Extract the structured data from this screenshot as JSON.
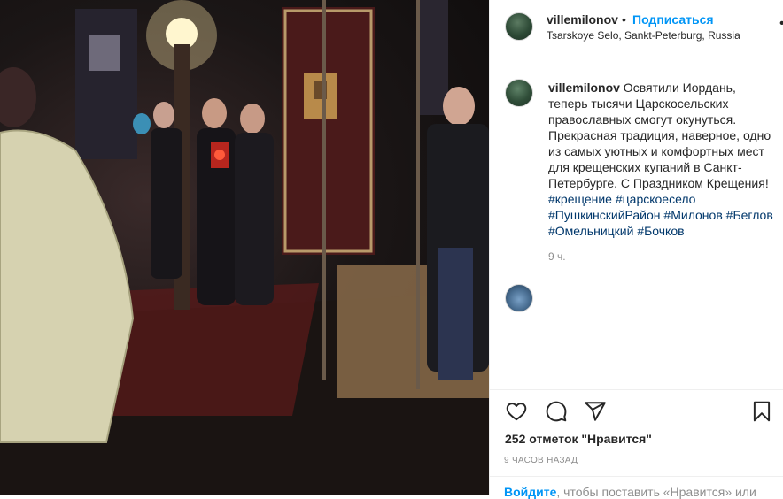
{
  "post": {
    "image_alt": "",
    "author": "villemilonov",
    "separator": "•",
    "follow_label": "Подписаться",
    "location": "Tsarskoye Selo, Sankt-Peterburg, Russia",
    "more_label": "•••"
  },
  "caption": {
    "author": "villemilonov",
    "text": " Освятили Иордань, теперь тысячи Царскосельских православных смогут окунуться. Прекрасная традиция, наверное, одно из самых уютных и комфортных мест для крещенских купаний в Санкт-Петербурге. С Праздником Крещения! ",
    "hashtags": [
      "#крещение",
      "#царскоеселo",
      "#ПушкинскийРайон",
      "#Милонов",
      "#Беглов",
      "#Омельницкий",
      "#Бочков"
    ],
    "age": "9 ч."
  },
  "actions": {
    "like_icon": "heart-icon",
    "comment_icon": "comment-icon",
    "share_icon": "share-icon",
    "save_icon": "bookmark-icon"
  },
  "likes_text": "252 отметок \"Нравится\"",
  "posted_time": "9 ЧАСОВ НАЗАД",
  "footer": {
    "login_link": "Войдите",
    "login_rest": ", чтобы поставить «Нравится» или"
  }
}
